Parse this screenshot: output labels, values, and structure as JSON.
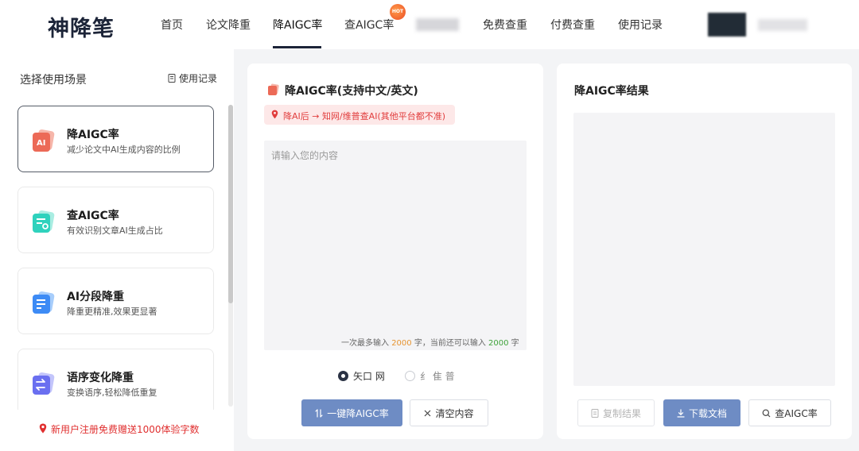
{
  "header": {
    "logo": "神降笔",
    "nav": [
      {
        "label": "首页"
      },
      {
        "label": "论文降重"
      },
      {
        "label": "降AIGC率",
        "active": true
      },
      {
        "label": "查AIGC率",
        "badge": "HOT"
      },
      {
        "label": "免费查重"
      },
      {
        "label": "付费查重"
      },
      {
        "label": "使用记录"
      }
    ]
  },
  "sidebar": {
    "title": "选择使用场景",
    "record_link": "使用记录",
    "cards": [
      {
        "title": "降AIGC率",
        "desc": "减少论文中AI生成内容的比例",
        "icon": "ai-reduce-icon",
        "selected": true
      },
      {
        "title": "查AIGC率",
        "desc": "有效识别文章AI生成占比",
        "icon": "ai-check-icon"
      },
      {
        "title": "AI分段降重",
        "desc": "降重更精准,效果更显著",
        "icon": "segment-icon"
      },
      {
        "title": "语序变化降重",
        "desc": "变换语序,轻松降低重复",
        "icon": "reorder-icon"
      }
    ],
    "promo": "新用户注册免费赠送1000体验字数"
  },
  "input_panel": {
    "title": "降AIGC率(支持中文/英文)",
    "warning": "降AI后 → 知网/维普查AI(其他平台都不准)",
    "placeholder": "请输入您的内容",
    "counter": {
      "prefix": "一次最多输入",
      "max": "2000",
      "mid": "字，当前还可以输入",
      "left": "2000",
      "suffix": "字"
    },
    "radios": [
      {
        "label": "矢口 网",
        "checked": true
      },
      {
        "label": "纟 隹 普",
        "checked": false
      }
    ],
    "primary_button": "一键降AIGC率",
    "clear_button": "清空内容"
  },
  "result_panel": {
    "title": "降AIGC率结果",
    "copy_button": "复制结果",
    "download_button": "下载文档",
    "check_button": "查AIGC率"
  },
  "colors": {
    "primary": "#6e8cc4",
    "dark": "#1c2438",
    "warning": "#e13d3d",
    "orange_count": "#e69431",
    "green_count": "#3ea33a"
  }
}
